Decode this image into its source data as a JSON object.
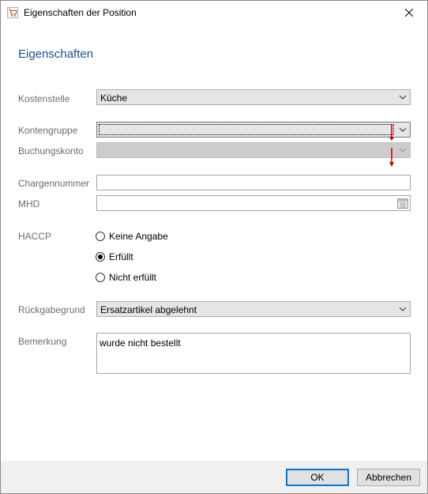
{
  "window": {
    "title": "Eigenschaften der Position"
  },
  "section": {
    "title": "Eigenschaften"
  },
  "fields": {
    "kostenstelle": {
      "label": "Kostenstelle",
      "value": "Küche"
    },
    "kontengruppe": {
      "label": "Kontengruppe",
      "value": ""
    },
    "buchungskonto": {
      "label": "Buchungskonto",
      "value": ""
    },
    "chargennummer": {
      "label": "Chargennummer",
      "value": ""
    },
    "mhd": {
      "label": "MHD",
      "value": ""
    },
    "haccp": {
      "label": "HACCP",
      "options": [
        {
          "label": "Keine Angabe",
          "checked": false
        },
        {
          "label": "Erfüllt",
          "checked": true
        },
        {
          "label": "Nicht erfüllt",
          "checked": false
        }
      ]
    },
    "rueckgabegrund": {
      "label": "Rückgabegrund",
      "value": "Ersatzartikel abgelehnt"
    },
    "bemerkung": {
      "label": "Bemerkung",
      "value": "wurde nicht bestellt"
    }
  },
  "buttons": {
    "ok": "OK",
    "cancel": "Abbrechen"
  },
  "colors": {
    "accent": "#1f4e8c",
    "default_button_border": "#0078d7",
    "annotation_arrow": "#c00000"
  },
  "icons": {
    "app": "cart-icon",
    "close": "close-icon",
    "dropdown": "chevron-down-icon",
    "calendar": "calendar-icon"
  }
}
